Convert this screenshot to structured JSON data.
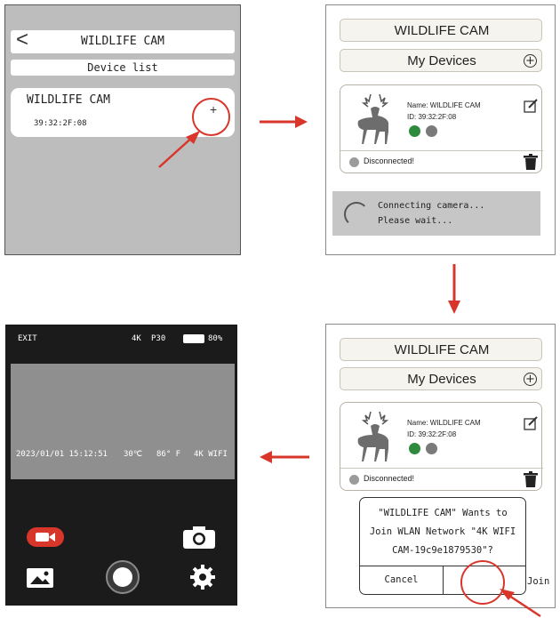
{
  "panel1": {
    "back_glyph": "<",
    "title": "WILDLIFE CAM",
    "device_list_label": "Device list",
    "device_name": "WILDLIFE CAM",
    "device_id": "39:32:2F:08",
    "add_glyph": "+"
  },
  "panel2": {
    "title": "WILDLIFE CAM",
    "my_devices": "My Devices",
    "plus_glyph": "+",
    "name_line": "Name: WILDLIFE CAM",
    "id_line": "ID: 39:32:2F:08",
    "status": "Disconnected!",
    "connecting_line1": "Connecting camera...",
    "connecting_line2": "Please wait..."
  },
  "panel3": {
    "title": "WILDLIFE CAM",
    "my_devices": "My Devices",
    "plus_glyph": "+",
    "name_line": "Name: WILDLIFE CAM",
    "id_line": "ID: 39:32:2F:08",
    "status": "Disconnected!",
    "dialog_line1": "\"WILDLIFE CAM\" Wants to",
    "dialog_line2": "Join WLAN Network \"4K WIFI",
    "dialog_line3": "CAM-19c9e1879530\"?",
    "cancel_label": "Cancel",
    "join_label": "Join"
  },
  "panel4": {
    "exit_label": "EXIT",
    "resolution": "4K",
    "fps": "P30",
    "battery": "80%",
    "overlay_date": "2023/01/01 15:12:51",
    "overlay_temp_c": "30℃",
    "overlay_temp_f": "86° F",
    "overlay_ssid": "4K WIFI"
  },
  "colors": {
    "accent_red": "#d9362b",
    "bluetooth_green": "#2e8b3e",
    "panel_gray": "#bdbdbd",
    "dark_bg": "#1b1b1b"
  },
  "icons": [
    "back-icon",
    "plus-circle-icon",
    "deer-icon",
    "bluetooth-icon",
    "wifi-icon",
    "edit-icon",
    "trash-icon",
    "check-circle-icon",
    "spinner-icon",
    "record-icon",
    "camera-icon",
    "gallery-icon",
    "shutter-icon",
    "gear-icon",
    "battery-icon"
  ]
}
